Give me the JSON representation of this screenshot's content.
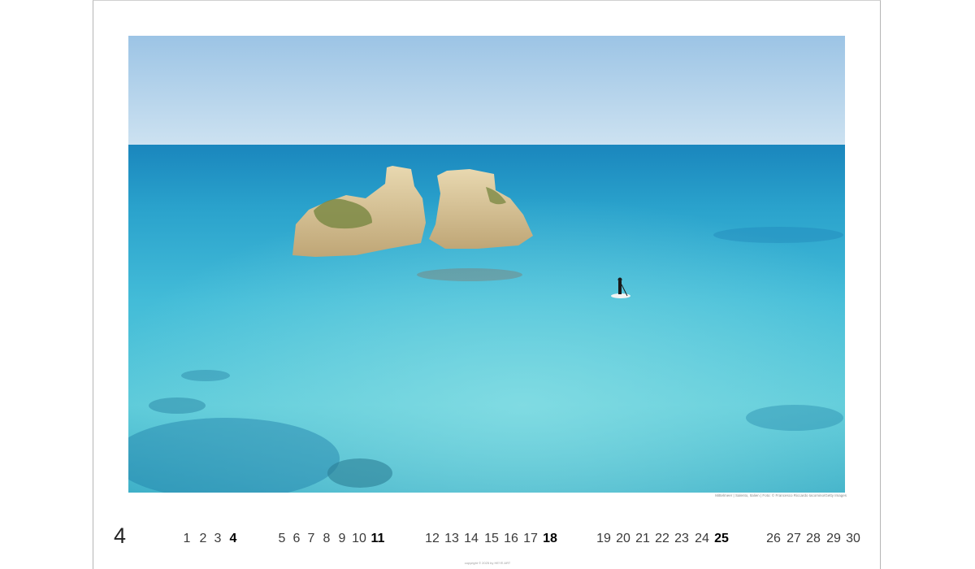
{
  "calendar": {
    "month_number": "4",
    "days": [
      {
        "label": "1",
        "sunday": false
      },
      {
        "label": "2",
        "sunday": false
      },
      {
        "label": "3",
        "sunday": false
      },
      {
        "label": "4",
        "sunday": true
      },
      {
        "label": "5",
        "sunday": false
      },
      {
        "label": "6",
        "sunday": false
      },
      {
        "label": "7",
        "sunday": false
      },
      {
        "label": "8",
        "sunday": false
      },
      {
        "label": "9",
        "sunday": false
      },
      {
        "label": "10",
        "sunday": false
      },
      {
        "label": "11",
        "sunday": true
      },
      {
        "label": "12",
        "sunday": false
      },
      {
        "label": "13",
        "sunday": false
      },
      {
        "label": "14",
        "sunday": false
      },
      {
        "label": "15",
        "sunday": false
      },
      {
        "label": "16",
        "sunday": false
      },
      {
        "label": "17",
        "sunday": false
      },
      {
        "label": "18",
        "sunday": true
      },
      {
        "label": "19",
        "sunday": false
      },
      {
        "label": "20",
        "sunday": false
      },
      {
        "label": "21",
        "sunday": false
      },
      {
        "label": "22",
        "sunday": false
      },
      {
        "label": "23",
        "sunday": false
      },
      {
        "label": "24",
        "sunday": false
      },
      {
        "label": "25",
        "sunday": true
      },
      {
        "label": "26",
        "sunday": false
      },
      {
        "label": "27",
        "sunday": false
      },
      {
        "label": "28",
        "sunday": false
      },
      {
        "label": "29",
        "sunday": false
      },
      {
        "label": "30",
        "sunday": false
      }
    ]
  },
  "photo": {
    "credit": "Mittelmeer | Salento, Italien | Foto: © Francesco Riccardo Iacomino/Getty Images",
    "copyright": "copyright © 2025 by HEYE ART"
  },
  "colors": {
    "sky_top": "#9fc6e6",
    "sky_horizon": "#c9e0f0",
    "sea_deep": "#1c8fc0",
    "sea_mid": "#3db7d6",
    "sea_shallow": "#6fd3e0",
    "rock": "#d9c59a"
  }
}
